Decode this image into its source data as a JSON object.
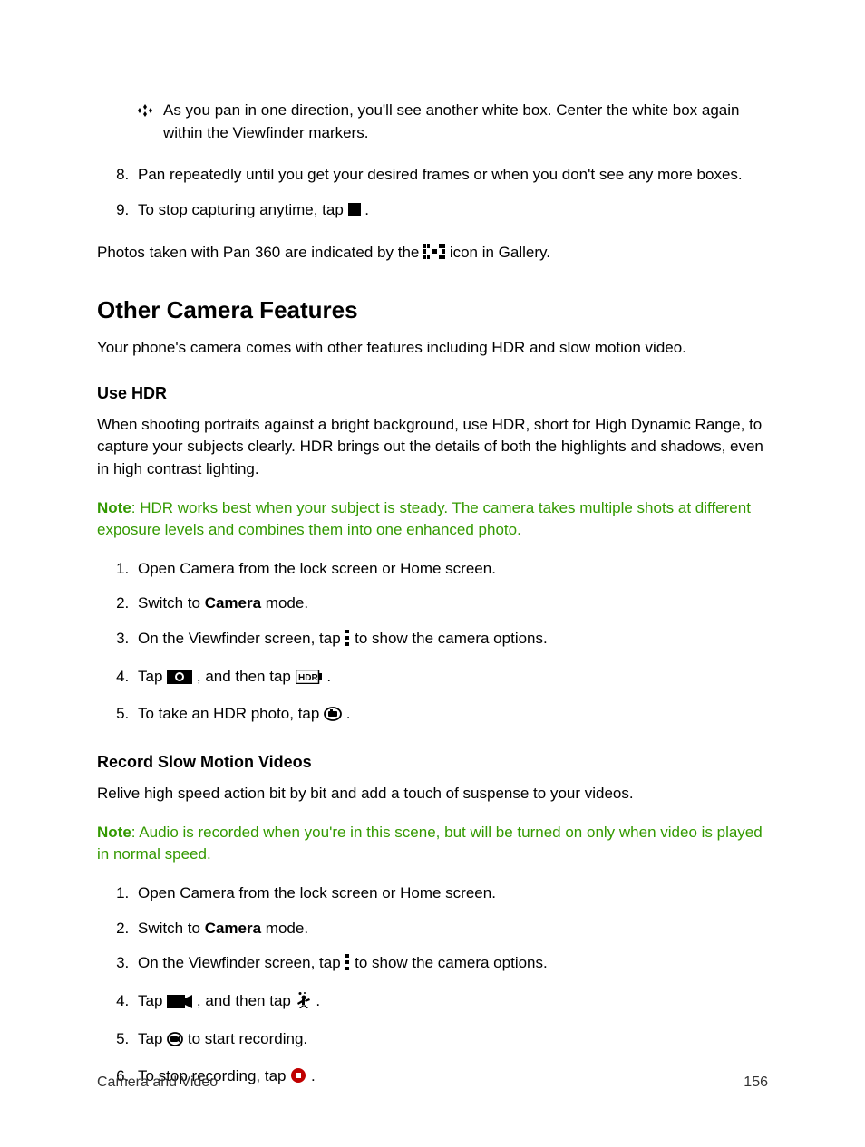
{
  "tip_text": "As you pan in one direction, you'll see another white box. Center the white box again within the Viewfinder markers.",
  "top_list": {
    "start": 8,
    "items": [
      {
        "pre": "Pan repeatedly until you get your desired frames or when you don't see any more boxes."
      },
      {
        "pre": "To stop capturing anytime, tap ",
        "post": "."
      }
    ]
  },
  "gallery_note": {
    "pre": "Photos taken with Pan 360 are indicated by the ",
    "post": " icon in Gallery."
  },
  "h2": "Other Camera Features",
  "intro": "Your phone's camera comes with other features including HDR and slow motion video.",
  "hdr": {
    "heading": "Use HDR",
    "desc": "When shooting portraits against a bright background, use HDR, short for High Dynamic Range, to capture your subjects clearly. HDR brings out the details of both the highlights and shadows, even in high contrast lighting.",
    "note_label": "Note",
    "note_body": ": HDR works best when your subject is steady. The camera takes multiple shots at different exposure levels and combines them into one enhanced photo.",
    "steps": [
      {
        "pre": "Open Camera from the lock screen or Home screen."
      },
      {
        "pre": "Switch to ",
        "bold": "Camera",
        "post": " mode."
      },
      {
        "pre": "On the Viewfinder screen, tap ",
        "post": " to show the camera options."
      },
      {
        "pre": "Tap ",
        "mid": ", and then tap ",
        "post": "."
      },
      {
        "pre": "To take an HDR photo, tap ",
        "post": "."
      }
    ]
  },
  "slowmo": {
    "heading": "Record Slow Motion Videos",
    "desc": "Relive high speed action bit by bit and add a touch of suspense to your videos.",
    "note_label": "Note",
    "note_body": ": Audio is recorded when you're in this scene, but will be turned on only when video is played in normal speed.",
    "steps": [
      {
        "pre": "Open Camera from the lock screen or Home screen."
      },
      {
        "pre": "Switch to ",
        "bold": "Camera",
        "post": " mode."
      },
      {
        "pre": "On the Viewfinder screen, tap ",
        "post": " to show the camera options."
      },
      {
        "pre": "Tap ",
        "mid": ", and then tap ",
        "post": "."
      },
      {
        "pre": "Tap ",
        "post": " to start recording."
      },
      {
        "pre": "To stop recording, tap ",
        "post": "."
      }
    ]
  },
  "footer": {
    "left": "Camera and Video",
    "right": "156"
  }
}
